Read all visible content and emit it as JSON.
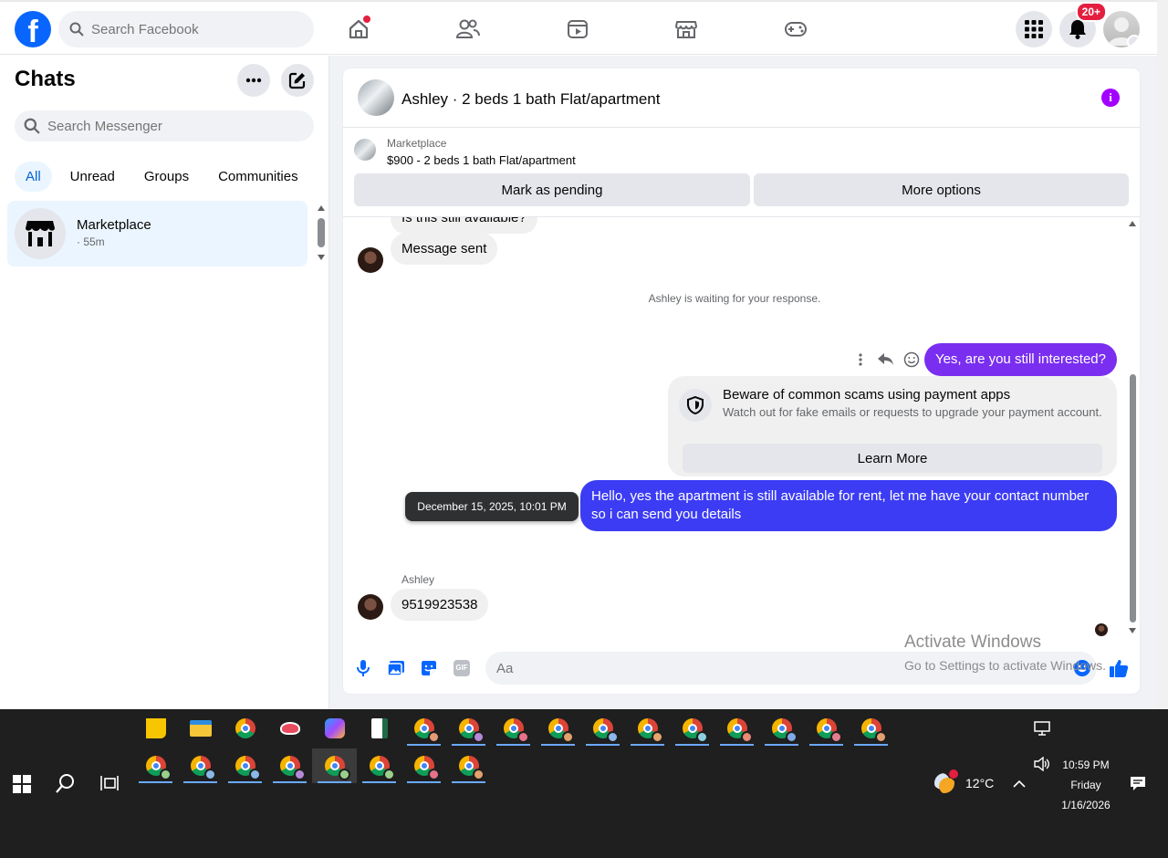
{
  "topbar": {
    "logo": "f",
    "search_placeholder": "Search Facebook",
    "notifications_badge": "20+",
    "icons": [
      "home-icon",
      "friends-icon",
      "video-icon",
      "marketplace-icon",
      "gaming-icon",
      "menu-grid-icon",
      "bell-icon"
    ]
  },
  "sidebar": {
    "title": "Chats",
    "search_placeholder": "Search Messenger",
    "tabs": [
      "All",
      "Unread",
      "Groups",
      "Communities"
    ],
    "active_tab": "All",
    "chats": [
      {
        "name": "Marketplace",
        "subtitle": "· 55m"
      }
    ]
  },
  "conversation": {
    "title": "Ashley · 2 beds 1 bath Flat/apartment",
    "marketplace_label": "Marketplace",
    "listing": "$900 - 2 beds 1 bath Flat/apartment",
    "buttons": {
      "pending": "Mark as pending",
      "more": "More options"
    },
    "messages": {
      "partial": "Is this still available?",
      "sent_notice": "Message sent",
      "waiting": "Ashley is waiting for your response.",
      "out1": "Yes, are you still interested?",
      "out2": "Hello, yes the apartment is still available for rent, let me have your contact number so i can send you details",
      "tooltip": "December 15, 2025, 10:01 PM",
      "sender": "Ashley",
      "in_last": "9519923538"
    },
    "scam_card": {
      "title": "Beware of common scams using payment apps",
      "body": "Watch out for fake emails or requests to upgrade your payment account.",
      "button": "Learn More"
    },
    "composer_placeholder": "Aa",
    "gif_label": "GIF"
  },
  "watermark": {
    "line1": "Activate Windows",
    "line2": "Go to Settings to activate Windows."
  },
  "taskbar": {
    "temperature": "12°C",
    "time": "10:59 PM",
    "day": "Friday",
    "date": "1/16/2026"
  },
  "colors": {
    "facebook_blue": "#0866ff",
    "outgoing_purple": "#7a2ef0",
    "outgoing_blue": "#3c3cf5",
    "info_purple": "#a200ff",
    "badge_red": "#e41e3f"
  }
}
